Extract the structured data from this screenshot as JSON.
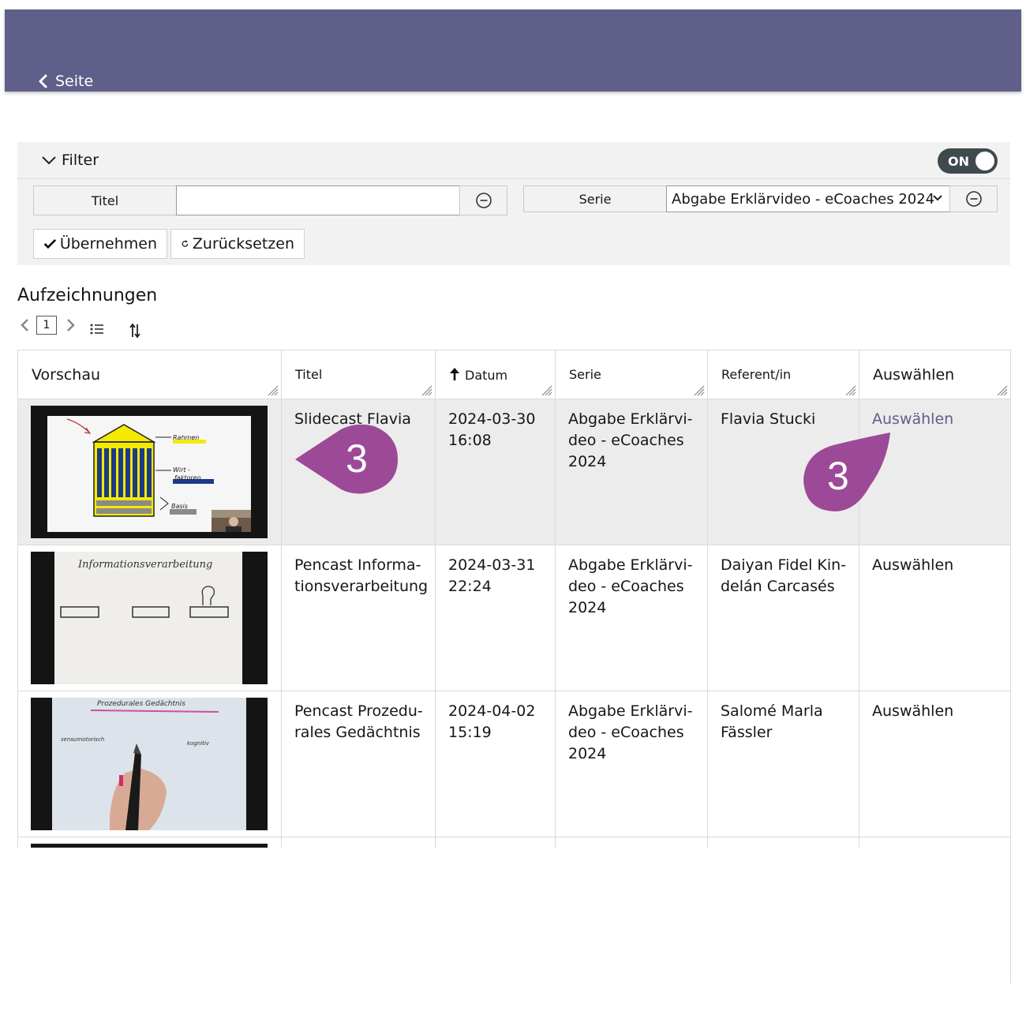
{
  "header": {
    "back_label": "Seite",
    "bar_color": "#5f5f8a"
  },
  "filter": {
    "title": "Filter",
    "toggle_label": "ON",
    "title_field": {
      "label": "Titel",
      "value": ""
    },
    "series_field": {
      "label": "Serie",
      "selected": "Abgabe Erklärvideo - eCoaches 2024"
    },
    "apply_label": "Übernehmen",
    "reset_label": "Zurücksetzen"
  },
  "recordings": {
    "title": "Aufzeichnungen",
    "page": "1",
    "columns": [
      "Vorschau",
      "Titel",
      "Datum",
      "Serie",
      "Referent/in",
      "Auswählen"
    ],
    "rows": [
      {
        "title": "Slidecast Flavia",
        "date": "2024-03-30",
        "time": "16:08",
        "series": "Abgabe Erklärvi-deo - eCoaches 2024",
        "presenter": "Flavia Stucki",
        "select": "Auswählen"
      },
      {
        "title": "Pencast Informa-tionsverarbeitung",
        "date": "2024-03-31",
        "time": "22:24",
        "series": "Abgabe Erklärvi-deo - eCoaches 2024",
        "presenter": "Daiyan Fidel Kin-delán Carcasés",
        "select": "Auswählen"
      },
      {
        "title": "Pencast Prozedu-rales Gedächtnis",
        "date": "2024-04-02",
        "time": "15:19",
        "series": "Abgabe Erklärvi-deo - eCoaches 2024",
        "presenter": "Salomé Marla Fässler",
        "select": "Auswählen"
      }
    ]
  },
  "thumbnails": {
    "t1": {
      "labels": [
        "Rahmen",
        "Wirt -",
        "faktoren",
        "Basis"
      ]
    },
    "t2": {
      "heading": "Informationsverarbeitung"
    },
    "t3": {
      "heading": "Prozedurales Gedächtnis",
      "left": "sensumotorisch",
      "right": "kognitiv"
    }
  },
  "annotations": {
    "badge_number": "3",
    "badge_color": "#9c4a97"
  }
}
